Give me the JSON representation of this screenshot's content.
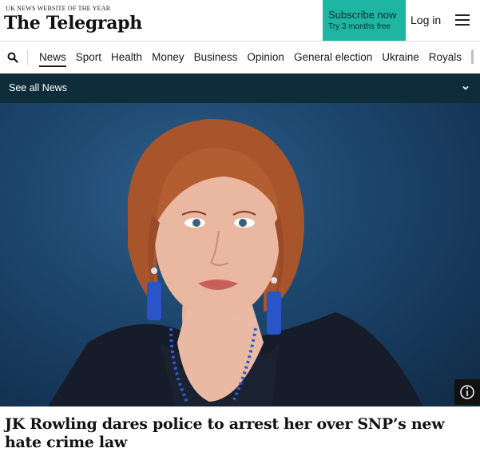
{
  "header": {
    "tagline": "UK NEWS WEBSITE OF THE YEAR",
    "logo": "The Telegraph",
    "subscribe_main": "Subscribe now",
    "subscribe_sub": "Try 3 months free",
    "login": "Log in"
  },
  "nav": {
    "items": [
      {
        "label": "News",
        "active": true
      },
      {
        "label": "Sport"
      },
      {
        "label": "Health"
      },
      {
        "label": "Money"
      },
      {
        "label": "Business"
      },
      {
        "label": "Opinion"
      },
      {
        "label": "General election"
      },
      {
        "label": "Ukraine"
      },
      {
        "label": "Royals"
      }
    ]
  },
  "section_bar": {
    "label": "See all News"
  },
  "article": {
    "headline": "JK Rowling dares police to arrest her over SNP’s new hate crime law"
  },
  "colors": {
    "subscribe_bg": "#1fb5a3",
    "section_bar_bg": "#0f2c3a"
  },
  "icons": [
    "search-icon",
    "hamburger-menu-icon",
    "chevron-down-icon",
    "info-icon"
  ]
}
